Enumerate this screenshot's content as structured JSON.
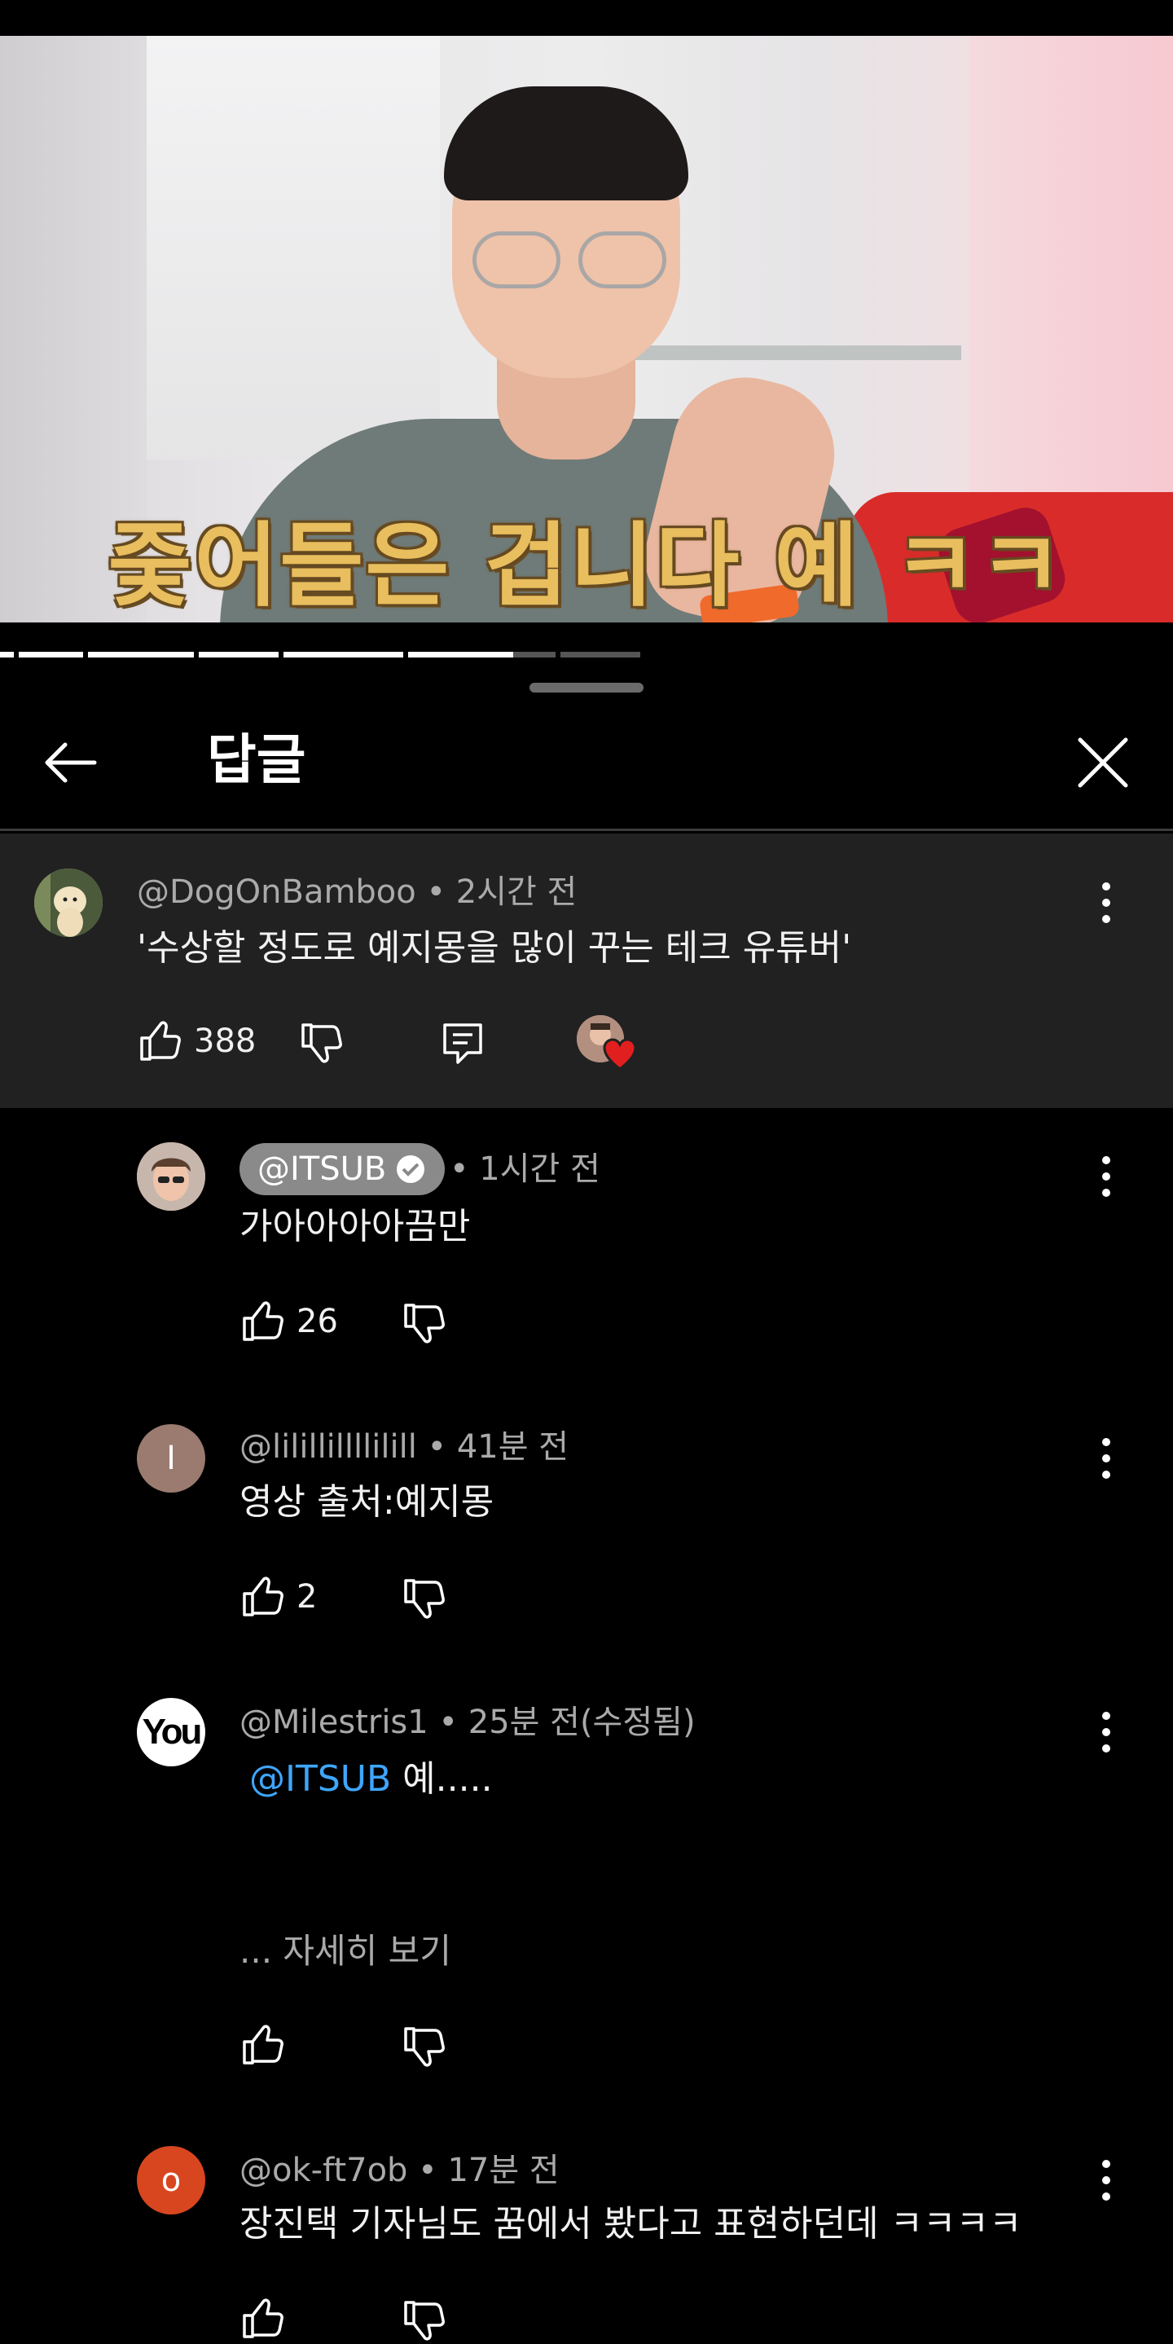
{
  "video": {
    "caption": "줒어들은 겁니다 예 ㅋㅋ"
  },
  "progress_segments": [
    {
      "width": 0.012,
      "fill": 1
    },
    {
      "width": 0.055,
      "fill": 1
    },
    {
      "width": 0.09,
      "fill": 1
    },
    {
      "width": 0.068,
      "fill": 1
    },
    {
      "width": 0.102,
      "fill": 1
    },
    {
      "width": 0.126,
      "fill": 0.71
    },
    {
      "width": 0.068,
      "fill": 0
    }
  ],
  "header": {
    "title": "답글"
  },
  "parent_comment": {
    "author": "@DogOnBamboo",
    "time": " • 2시간 전",
    "text": "'수상할 정도로 예지몽을 많이 꾸는 테크 유튜버'",
    "likes": "388"
  },
  "replies": [
    {
      "author": "@ITSUB",
      "time": "• 1시간 전",
      "text": "가아아아아끔만",
      "likes": "26",
      "avatar_color": "#d8b4a0"
    },
    {
      "author": "@lilillillllilill",
      "time": " • 41분 전",
      "text": "영상 출처:예지몽",
      "likes": "2",
      "avatar_letter": "I",
      "avatar_color": "#9b7b70"
    },
    {
      "author": "@Milestris1",
      "time": " • 25분 전(수정됨)",
      "mention": "@ITSUB",
      "text": " 예.....",
      "read_more": "... 자세히 보기",
      "likes": "",
      "avatar_letter": "You",
      "avatar_color": "#ffffff"
    },
    {
      "author": "@ok-ft7ob",
      "time": " • 17분 전",
      "text": "장진택 기자님도 꿈에서 봤다고 표현하던데 ㅋㅋㅋㅋ",
      "likes": "",
      "avatar_letter": "o",
      "avatar_color": "#d8461f"
    }
  ]
}
